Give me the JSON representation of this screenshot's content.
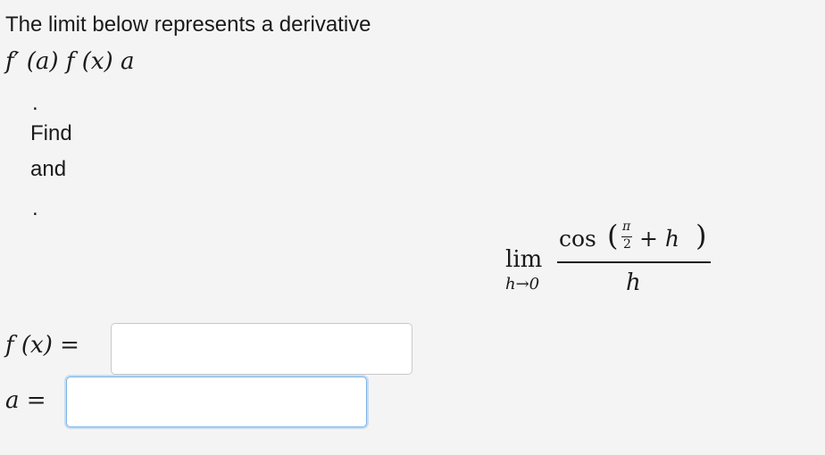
{
  "question": {
    "intro": "The limit below represents a derivative",
    "math_line": "f′ (a) f (x) a",
    "dot1": ".",
    "find": "Find",
    "and": "and",
    "dot2": "."
  },
  "limit": {
    "lim": "lim",
    "sub": "h→0",
    "func": "cos",
    "pi": "π",
    "two": "2",
    "plus_h": "+ h",
    "denominator": "h"
  },
  "answers": {
    "fx_label": "f (x) =",
    "fx_value": "",
    "a_label": "a =",
    "a_value": ""
  }
}
